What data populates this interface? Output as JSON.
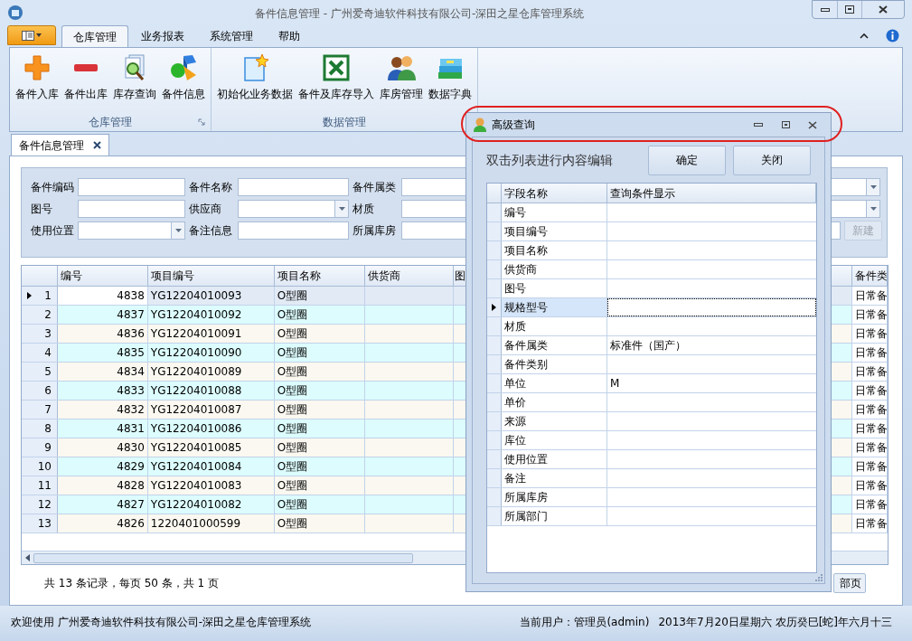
{
  "window": {
    "title": "备件信息管理 - 广州爱奇迪软件科技有限公司-深田之星仓库管理系统"
  },
  "ribbon": {
    "tabs": [
      {
        "label": "仓库管理",
        "selected": true
      },
      {
        "label": "业务报表",
        "selected": false
      },
      {
        "label": "系统管理",
        "selected": false
      },
      {
        "label": "帮助",
        "selected": false
      }
    ],
    "groups": [
      {
        "label": "仓库管理",
        "launcher": true,
        "buttons": [
          "备件入库",
          "备件出库",
          "库存查询",
          "备件信息"
        ]
      },
      {
        "label": "数据管理",
        "launcher": false,
        "buttons": [
          "初始化业务数据",
          "备件及库存导入",
          "库房管理",
          "数据字典"
        ]
      }
    ]
  },
  "document_tabs": [
    {
      "label": "备件信息管理",
      "selected": true
    }
  ],
  "filters": [
    {
      "label": "备件编码",
      "kind": "text"
    },
    {
      "label": "备件名称",
      "kind": "text"
    },
    {
      "label": "备件属类",
      "kind": "dropdown"
    },
    {
      "label": "图号",
      "kind": "text"
    },
    {
      "label": "供应商",
      "kind": "dropdown"
    },
    {
      "label": "材质",
      "kind": "dropdown"
    },
    {
      "label": "使用位置",
      "kind": "dropdown"
    },
    {
      "label": "备注信息",
      "kind": "text"
    },
    {
      "label": "所属库房",
      "kind": "text"
    }
  ],
  "new_button": {
    "label": "新建",
    "disabled": true
  },
  "grid": {
    "columns": [
      "编号",
      "项目编号",
      "项目名称",
      "供货商",
      "图",
      "备件类"
    ],
    "rows": [
      {
        "row_header": "1",
        "selected": true,
        "number": "4838",
        "item_code": "YG12204010093",
        "item_name": "O型圈",
        "category": "日常备"
      },
      {
        "row_header": "2",
        "selected": false,
        "number": "4837",
        "item_code": "YG12204010092",
        "item_name": "O型圈",
        "category": "日常备"
      },
      {
        "row_header": "3",
        "selected": false,
        "number": "4836",
        "item_code": "YG12204010091",
        "item_name": "O型圈",
        "category": "日常备"
      },
      {
        "row_header": "4",
        "selected": false,
        "number": "4835",
        "item_code": "YG12204010090",
        "item_name": "O型圈",
        "category": "日常备"
      },
      {
        "row_header": "5",
        "selected": false,
        "number": "4834",
        "item_code": "YG12204010089",
        "item_name": "O型圈",
        "category": "日常备"
      },
      {
        "row_header": "6",
        "selected": false,
        "number": "4833",
        "item_code": "YG12204010088",
        "item_name": "O型圈",
        "category": "日常备"
      },
      {
        "row_header": "7",
        "selected": false,
        "number": "4832",
        "item_code": "YG12204010087",
        "item_name": "O型圈",
        "category": "日常备"
      },
      {
        "row_header": "8",
        "selected": false,
        "number": "4831",
        "item_code": "YG12204010086",
        "item_name": "O型圈",
        "category": "日常备"
      },
      {
        "row_header": "9",
        "selected": false,
        "number": "4830",
        "item_code": "YG12204010085",
        "item_name": "O型圈",
        "category": "日常备"
      },
      {
        "row_header": "10",
        "selected": false,
        "number": "4829",
        "item_code": "YG12204010084",
        "item_name": "O型圈",
        "category": "日常备"
      },
      {
        "row_header": "11",
        "selected": false,
        "number": "4828",
        "item_code": "YG12204010083",
        "item_name": "O型圈",
        "category": "日常备"
      },
      {
        "row_header": "12",
        "selected": false,
        "number": "4827",
        "item_code": "YG12204010082",
        "item_name": "O型圈",
        "category": "日常备"
      },
      {
        "row_header": "13",
        "selected": false,
        "number": "4826",
        "item_code": "1220401000599",
        "item_name": "O型圈",
        "category": "日常备"
      }
    ]
  },
  "footer": {
    "summary": "共 13 条记录，每页 50 条，共 1 页",
    "page_button": "部页"
  },
  "dialog": {
    "title": "高级查询",
    "highlighted": true,
    "hint": "双击列表进行内容编辑",
    "buttons": [
      "确定",
      "关闭"
    ],
    "grid": {
      "columns": [
        "字段名称",
        "查询条件显示"
      ],
      "rows": [
        {
          "field": "编号",
          "selected": false
        },
        {
          "field": "项目编号",
          "selected": false
        },
        {
          "field": "项目名称",
          "selected": false
        },
        {
          "field": "供货商",
          "selected": false
        },
        {
          "field": "图号",
          "selected": false
        },
        {
          "field": "规格型号",
          "selected": true
        },
        {
          "field": "材质",
          "selected": false
        },
        {
          "field": "备件属类",
          "selected": false,
          "value": "标准件（国产）"
        },
        {
          "field": "备件类别",
          "selected": false
        },
        {
          "field": "单位",
          "selected": false,
          "value": "M"
        },
        {
          "field": "单价",
          "selected": false
        },
        {
          "field": "来源",
          "selected": false
        },
        {
          "field": "库位",
          "selected": false
        },
        {
          "field": "使用位置",
          "selected": false
        },
        {
          "field": "备注",
          "selected": false
        },
        {
          "field": "所属库房",
          "selected": false
        },
        {
          "field": "所属部门",
          "selected": false
        }
      ]
    }
  },
  "status_bar": {
    "welcome": "欢迎使用 广州爱奇迪软件科技有限公司-深田之星仓库管理系统",
    "user": "当前用户：管理员(admin)",
    "date": "2013年7月20日星期六 农历癸巳[蛇]年六月十三"
  }
}
